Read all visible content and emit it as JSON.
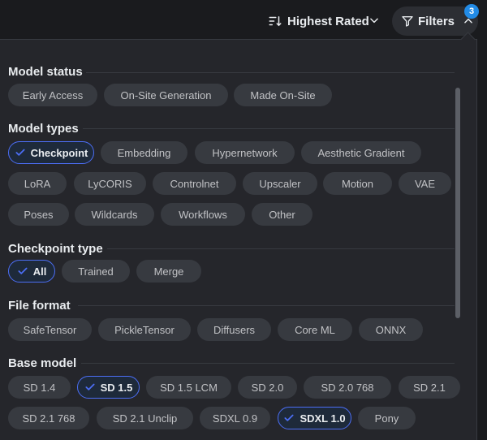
{
  "header": {
    "sort_label": "Highest Rated",
    "filters_label": "Filters",
    "filter_count": "3"
  },
  "sections": {
    "model_status": {
      "title": "Model status",
      "chips": [
        "Early Access",
        "On-Site Generation",
        "Made On-Site"
      ]
    },
    "model_types": {
      "title": "Model types",
      "chips": [
        "Checkpoint",
        "Embedding",
        "Hypernetwork",
        "Aesthetic Gradient",
        "LoRA",
        "LyCORIS",
        "Controlnet",
        "Upscaler",
        "Motion",
        "VAE",
        "Poses",
        "Wildcards",
        "Workflows",
        "Other"
      ],
      "selected": "Checkpoint"
    },
    "checkpoint_type": {
      "title": "Checkpoint type",
      "chips": [
        "All",
        "Trained",
        "Merge"
      ],
      "selected": "All"
    },
    "file_format": {
      "title": "File format",
      "chips": [
        "SafeTensor",
        "PickleTensor",
        "Diffusers",
        "Core ML",
        "ONNX"
      ]
    },
    "base_model": {
      "title": "Base model",
      "chips": [
        "SD 1.4",
        "SD 1.5",
        "SD 1.5 LCM",
        "SD 2.0",
        "SD 2.0 768",
        "SD 2.1",
        "SD 2.1 768",
        "SD 2.1 Unclip",
        "SDXL 0.9",
        "SDXL 1.0",
        "Pony"
      ],
      "selected": [
        "SD 1.5",
        "SDXL 1.0"
      ]
    }
  },
  "colors": {
    "accent": "#4c6ef5",
    "badge": "#228be6",
    "chip_bg": "#373a40",
    "panel_bg": "#25262b"
  }
}
